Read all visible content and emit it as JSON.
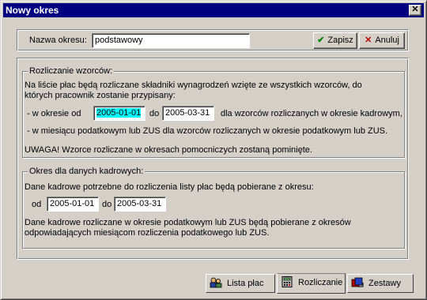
{
  "window": {
    "title": "Nowy okres"
  },
  "header": {
    "name_label": "Nazwa okresu:",
    "name_value": "podstawowy",
    "save_label": "Zapisz",
    "cancel_label": "Anuluj"
  },
  "templates": {
    "title": "Rozliczanie wzorców:",
    "intro_line1": "Na liście płac będą rozliczane składniki wynagrodzeń wzięte ze wszystkich wzorców, do",
    "intro_line2": "których pracownik zostanie przypisany:",
    "period_prefix": "- w okresie od",
    "date_from": "2005-01-01",
    "to_label": "do",
    "date_to": "2005-03-31",
    "period_suffix": "dla wzorców rozliczanych w okresie kadrowym,",
    "tax_line": "- w miesiącu podatkowym lub ZUS dla wzorców rozliczanych w okresie podatkowym lub ZUS.",
    "warning": "UWAGA! Wzorce rozliczane w okresach pomocniczych zostaną pominięte."
  },
  "hr": {
    "title": "Okres dla danych kadrowych:",
    "intro": "Dane kadrowe potrzebne do rozliczenia listy płac będą pobierane z okresu:",
    "from_label": "od",
    "date_from": "2005-01-01",
    "to_label": "do",
    "date_to": "2005-03-31",
    "note_line1": "Dane kadrowe rozliczane w okresie podatkowym lub ZUS będą pobierane z okresów",
    "note_line2": "odpowiadających miesiącom rozliczenia podatkowego lub ZUS."
  },
  "tabs": [
    {
      "label": "Lista płac",
      "icon": "people-icon"
    },
    {
      "label": "Rozliczanie",
      "icon": "calculator-icon"
    },
    {
      "label": "Zestawy",
      "icon": "sets-icon"
    }
  ],
  "colors": {
    "title_bar": "#000080",
    "selection": "#00ffff",
    "face": "#d4d0c8"
  }
}
